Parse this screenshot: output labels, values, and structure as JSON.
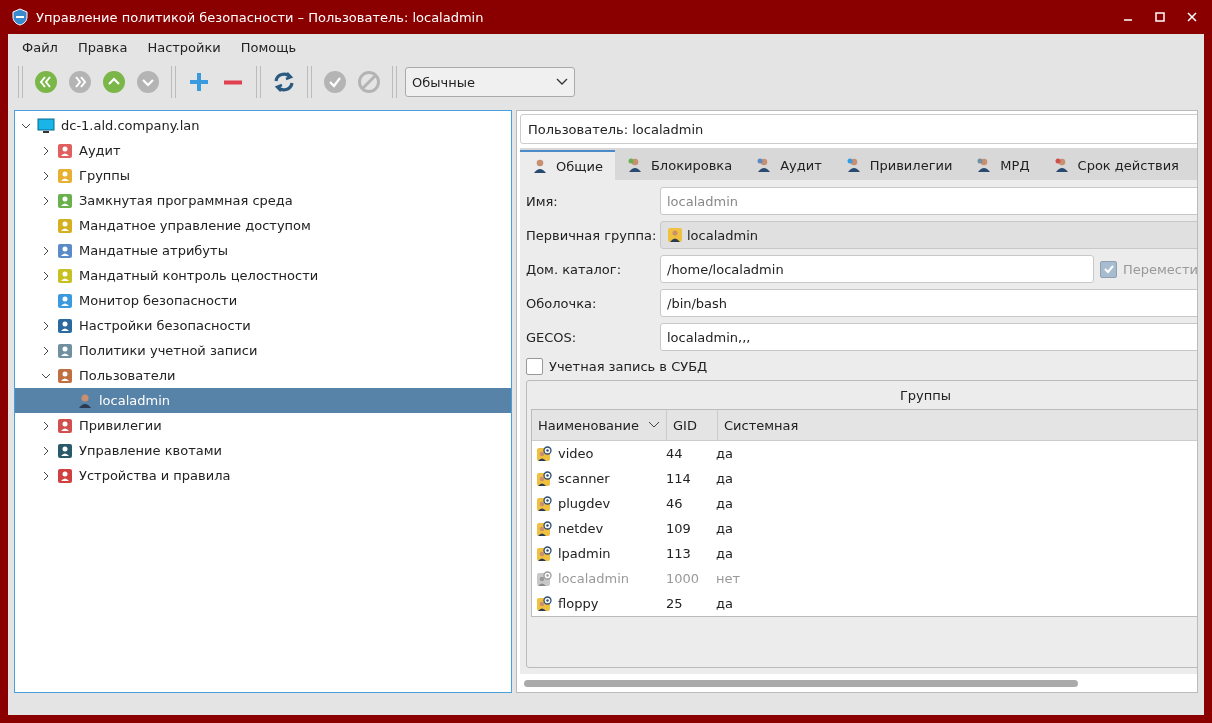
{
  "window": {
    "title": "Управление политикой безопасности – Пользователь: localadmin"
  },
  "menu": [
    "Файл",
    "Правка",
    "Настройки",
    "Помощь"
  ],
  "toolbar": [
    {
      "kind": "first",
      "disabled": false
    },
    {
      "kind": "last",
      "disabled": true
    },
    {
      "kind": "up",
      "disabled": false
    },
    {
      "kind": "down",
      "disabled": true
    },
    {
      "kind": "add",
      "disabled": false
    },
    {
      "kind": "remove",
      "disabled": false
    },
    {
      "kind": "refresh",
      "disabled": false
    },
    {
      "kind": "apply",
      "disabled": true
    },
    {
      "kind": "cancel",
      "disabled": true
    }
  ],
  "view_combo": {
    "value": "Обычные"
  },
  "tree": {
    "label": "dc-1.ald.company.lan",
    "expanded": true,
    "selected": false,
    "children": [
      {
        "label": "Аудит",
        "expanded": false,
        "selected": false
      },
      {
        "label": "Группы",
        "expanded": false,
        "selected": false
      },
      {
        "label": "Замкнутая программная среда",
        "expanded": false,
        "selected": false
      },
      {
        "label": "Мандатное управление доступом",
        "selected": false
      },
      {
        "label": "Мандатные атрибуты",
        "expanded": false,
        "selected": false
      },
      {
        "label": "Мандатный контроль целостности",
        "expanded": false,
        "selected": false
      },
      {
        "label": "Монитор безопасности",
        "selected": false
      },
      {
        "label": "Настройки безопасности",
        "expanded": false,
        "selected": false
      },
      {
        "label": "Политики учетной записи",
        "expanded": false,
        "selected": false
      },
      {
        "label": "Пользователи",
        "expanded": true,
        "selected": false,
        "children": [
          {
            "label": "localadmin",
            "selected": true
          }
        ]
      },
      {
        "label": "Привилегии",
        "expanded": false,
        "selected": false
      },
      {
        "label": "Управление квотами",
        "expanded": false,
        "selected": false
      },
      {
        "label": "Устройства и правила",
        "expanded": false,
        "selected": false
      }
    ]
  },
  "detail": {
    "header": "Пользователь: localadmin",
    "tabs": [
      {
        "label": "Общие",
        "selected": true
      },
      {
        "label": "Блокировка",
        "selected": false
      },
      {
        "label": "Аудит",
        "selected": false
      },
      {
        "label": "Привилегии",
        "selected": false
      },
      {
        "label": "МРД",
        "selected": false
      },
      {
        "label": "Срок действия",
        "selected": false
      }
    ],
    "fields": [
      {
        "label": "Имя:",
        "kind": "readonly",
        "value": "localadmin"
      },
      {
        "label": "Первичная группа:",
        "kind": "combo",
        "value": "localadmin"
      },
      {
        "label": "Дом. каталог:",
        "kind": "text",
        "value": "/home/localadmin",
        "checkbox": {
          "label": "Перемести",
          "checked": true,
          "disabled": true
        }
      },
      {
        "label": "Оболочка:",
        "kind": "text",
        "value": "/bin/bash"
      },
      {
        "label": "GECOS:",
        "kind": "text",
        "value": "localadmin,,,"
      }
    ],
    "dbms_checkbox": {
      "label": "Учетная запись в СУБД",
      "checked": false
    },
    "groups": {
      "title": "Группы",
      "columns": [
        "Наименование",
        "GID",
        "Системная"
      ],
      "rows": [
        {
          "name": "video",
          "gid": "44",
          "system": "да",
          "disabled": false
        },
        {
          "name": "scanner",
          "gid": "114",
          "system": "да",
          "disabled": false
        },
        {
          "name": "plugdev",
          "gid": "46",
          "system": "да",
          "disabled": false
        },
        {
          "name": "netdev",
          "gid": "109",
          "system": "да",
          "disabled": false
        },
        {
          "name": "lpadmin",
          "gid": "113",
          "system": "да",
          "disabled": false
        },
        {
          "name": "localadmin",
          "gid": "1000",
          "system": "нет",
          "disabled": true
        },
        {
          "name": "floppy",
          "gid": "25",
          "system": "да",
          "disabled": false
        }
      ]
    }
  }
}
